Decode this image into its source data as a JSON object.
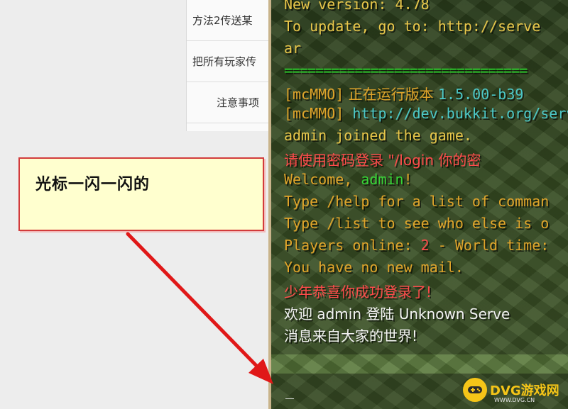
{
  "toc": {
    "items": [
      {
        "label": "方法2传送某"
      },
      {
        "label": "把所有玩家传"
      },
      {
        "label": "注意事项"
      }
    ]
  },
  "callout": {
    "text": "光标一闪一闪的"
  },
  "chat": {
    "lines": [
      {
        "text": " New version: 4.78",
        "color": "#e8c64a"
      },
      {
        "text": " To update, go to: http://serve",
        "color": "#e8c64a"
      },
      {
        "text": "ar",
        "color": "#e8c64a"
      },
      {
        "text": "===============================",
        "color": "#2bd62b"
      },
      {
        "prefix": "[mcMMO]",
        "text": " 正在运行版本 ",
        "extra": "1.5.00-b39"
      },
      {
        "prefix": "[mcMMO]",
        "text": " http://dev.bukkit.org/serv"
      },
      {
        "text": "admin joined the game.",
        "color": "#e8c64a"
      },
      {
        "text": "请使用密码登录 \"/login 你的密",
        "color": "#ff4b4b"
      },
      {
        "pre": "Welcome, ",
        "name": "admin",
        "post": "!"
      },
      {
        "text": "Type /help for a list of comman",
        "color": "#e0a42a"
      },
      {
        "text": "Type /list to see who else is o",
        "color": "#e0a42a"
      },
      {
        "pre": "Players online: ",
        "num": "2",
        "post": " - World time: "
      },
      {
        "text": "You have no new mail.",
        "color": "#e0a42a"
      },
      {
        "text": "少年恭喜你成功登录了!",
        "color": "#ff4b4b"
      },
      {
        "text": "欢迎 admin 登陆 Unknown Serve",
        "color": "#f2f2f2"
      },
      {
        "text": "消息来自大家的世界!",
        "color": "#f2f2f2"
      }
    ]
  },
  "input": {
    "cursor": "_"
  },
  "watermark": {
    "text": "DVG游戏网",
    "sub": "WWW.DVG.CN"
  }
}
